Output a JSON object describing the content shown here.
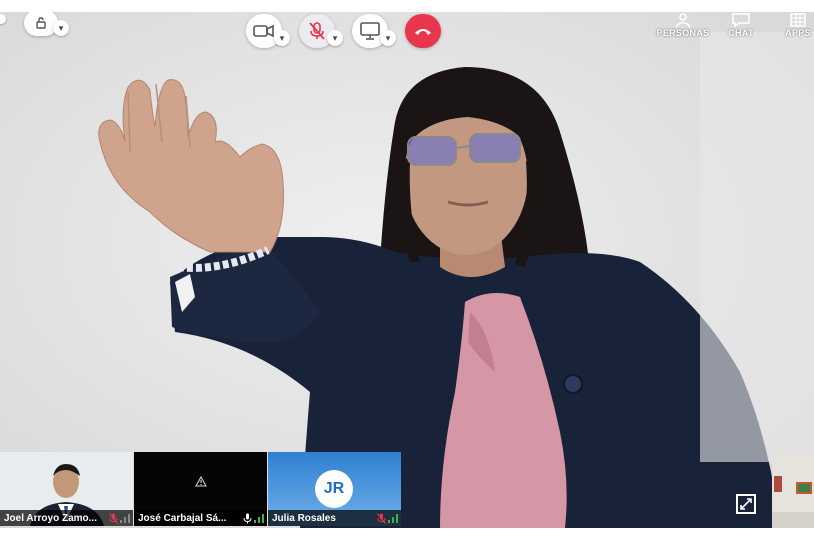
{
  "toolbar": {
    "right": [
      {
        "label": "PERSONAS",
        "icon": "people-icon"
      },
      {
        "label": "CHAT",
        "icon": "chat-icon"
      },
      {
        "label": "APPS",
        "icon": "apps-grid-icon"
      }
    ]
  },
  "participants": [
    {
      "name": "Joel Arroyo Zamo...",
      "mic": "muted"
    },
    {
      "name": "José Carbajal Sá...",
      "mic": "on"
    },
    {
      "name": "Julia Rosales",
      "mic": "muted",
      "initials": "JR"
    }
  ],
  "colors": {
    "hangup": "#e8364c",
    "muted": "#e8364c",
    "signal": "#3fb53f",
    "jr_tile": "#2f7fd1",
    "jacket": "#182238",
    "blouse": "#d596a6"
  }
}
